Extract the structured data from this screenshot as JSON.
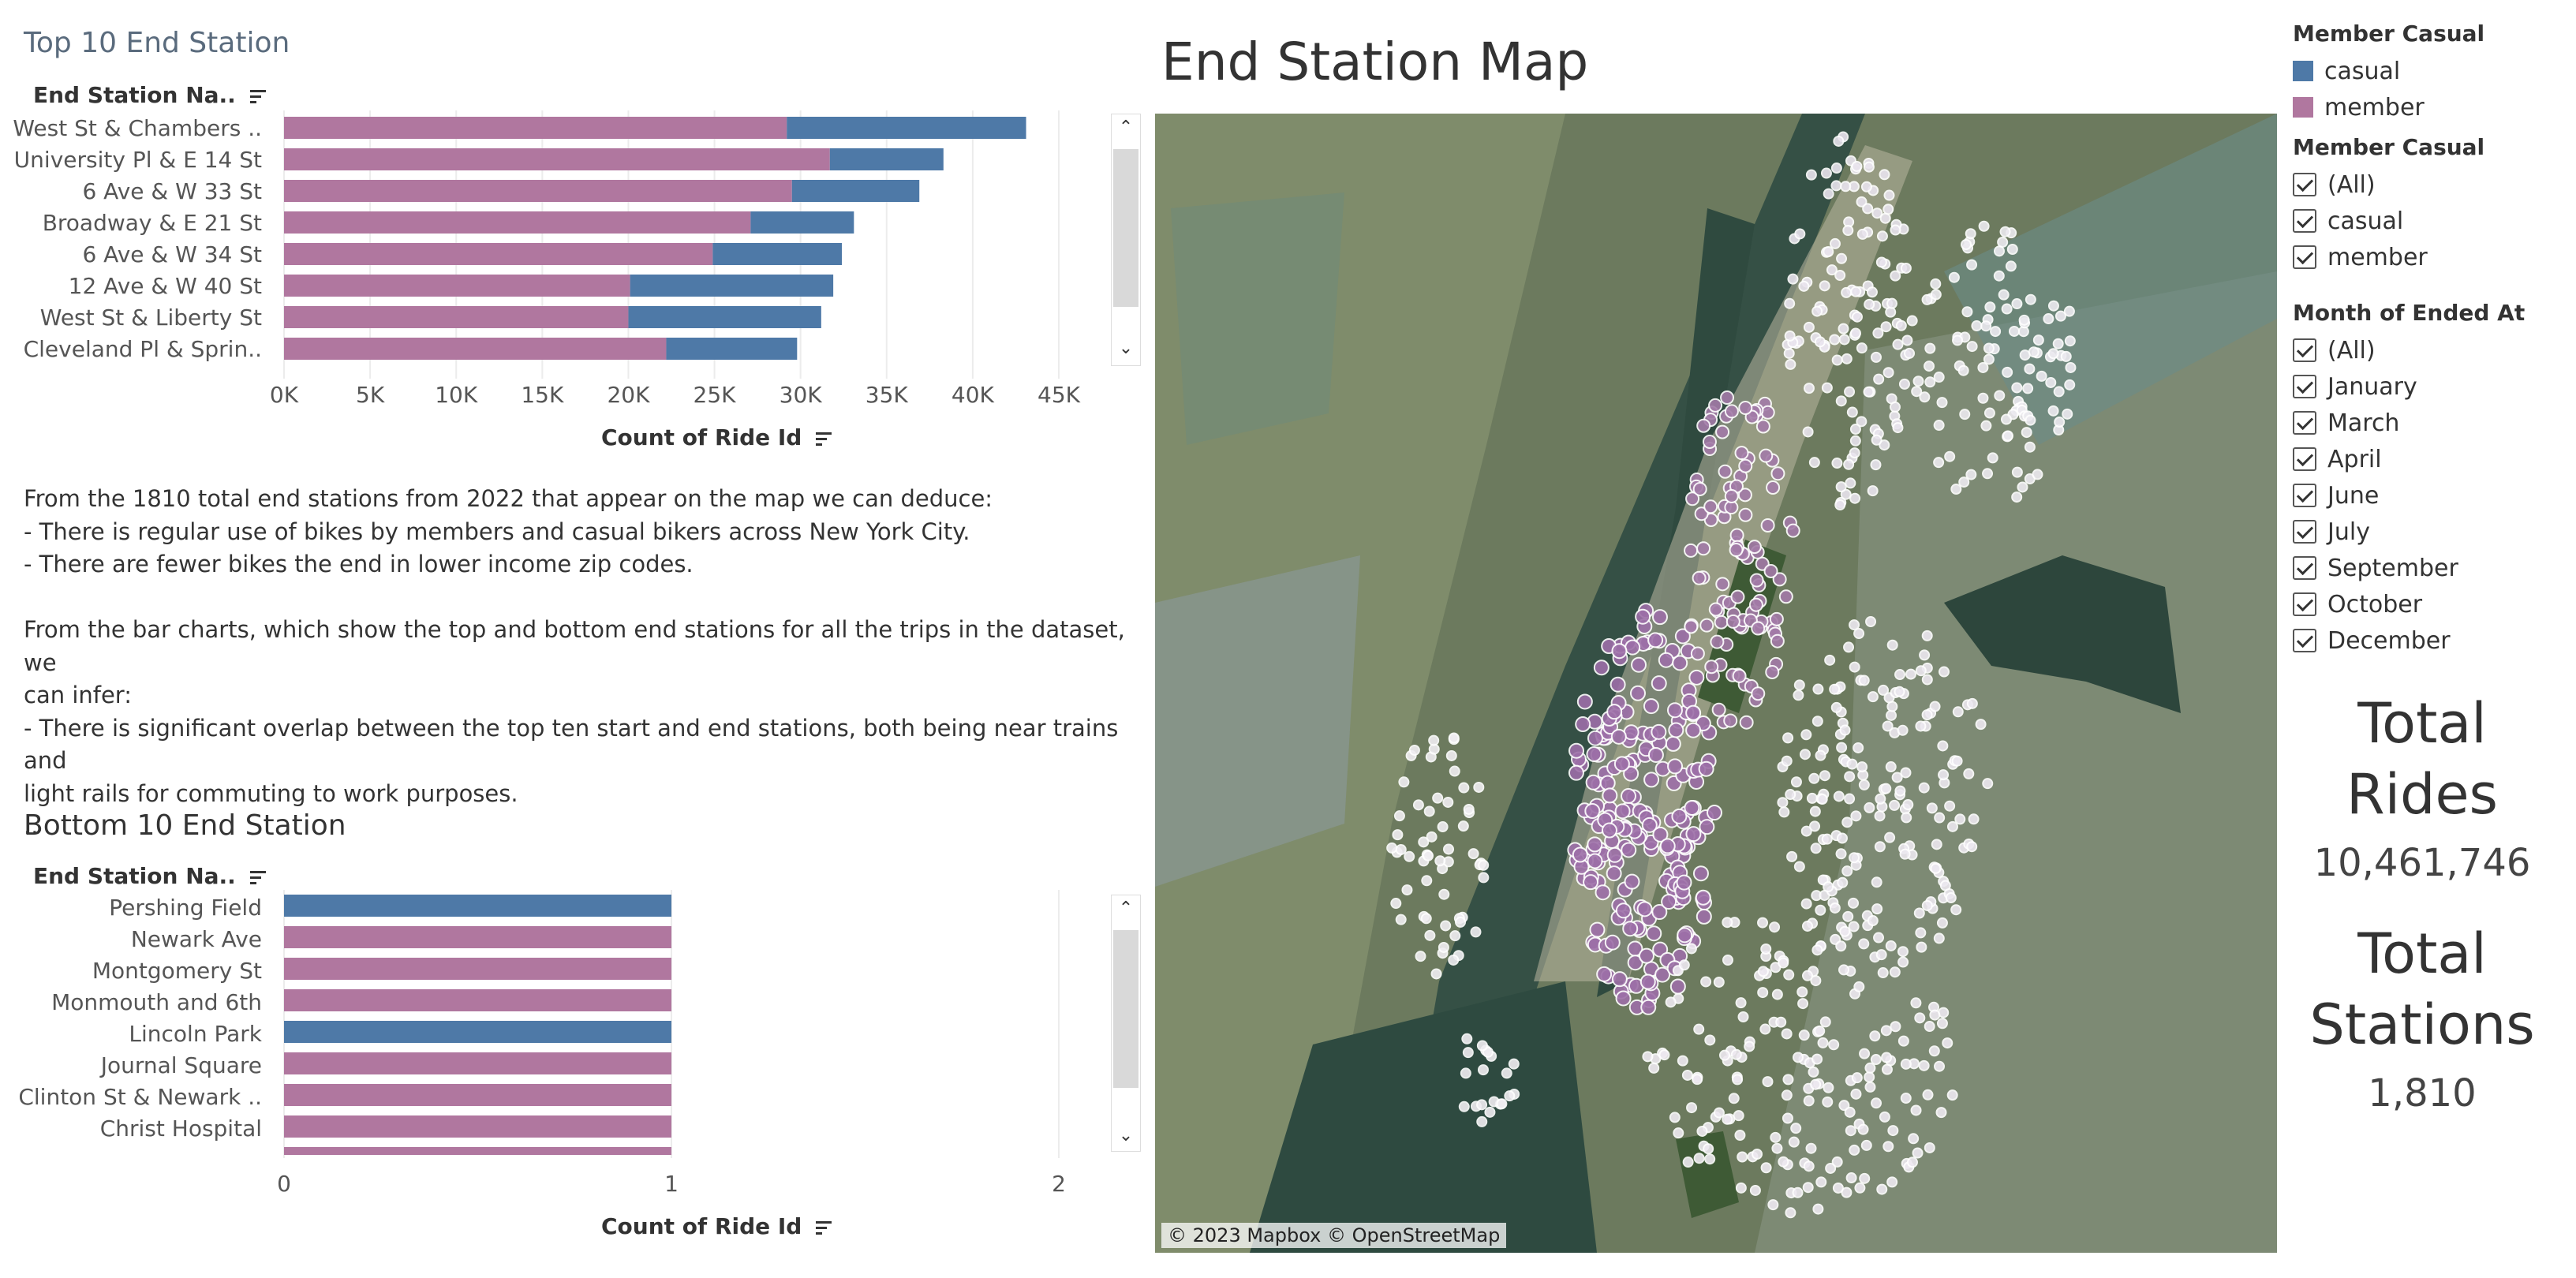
{
  "top_chart": {
    "title": "Top 10 End Station",
    "column_header": "End Station Na..",
    "axis_title": "Count of Ride Id",
    "ticks": [
      "0K",
      "5K",
      "10K",
      "15K",
      "20K",
      "25K",
      "30K",
      "35K",
      "40K",
      "45K"
    ]
  },
  "bottom_chart": {
    "title": "Bottom 10 End Station",
    "column_header": "End Station Na..",
    "axis_title": "Count of Ride Id",
    "ticks": [
      "0",
      "1",
      "2"
    ]
  },
  "chart_data": [
    {
      "type": "bar",
      "title": "Top 10 End Station",
      "ylabel": "End Station Na..",
      "xlabel": "Count of Ride Id",
      "xlim": [
        0,
        45000
      ],
      "stacked": true,
      "categories": [
        "West St & Chambers ..",
        "University Pl & E 14 St",
        "6 Ave & W 33 St",
        "Broadway & E 21 St",
        "6 Ave & W 34 St",
        "12 Ave & W 40 St",
        "West St & Liberty St",
        "Cleveland Pl & Sprin.."
      ],
      "series": [
        {
          "name": "member",
          "color": "#b0779f",
          "values": [
            29200,
            31700,
            29500,
            27100,
            24900,
            20100,
            20000,
            22200
          ]
        },
        {
          "name": "casual",
          "color": "#4e79a7",
          "values": [
            13900,
            6600,
            7400,
            6000,
            7500,
            11800,
            11200,
            7600
          ]
        }
      ]
    },
    {
      "type": "bar",
      "title": "Bottom 10 End Station",
      "ylabel": "End Station Na..",
      "xlabel": "Count of Ride Id",
      "xlim": [
        0,
        2
      ],
      "categories": [
        "Pershing Field",
        "Newark Ave",
        "Montgomery St",
        "Monmouth and 6th",
        "Lincoln Park",
        "Journal Square",
        "Clinton St & Newark ..",
        "Christ Hospital"
      ],
      "values": [
        1,
        1,
        1,
        1,
        1,
        1,
        1,
        1
      ],
      "colors": [
        "#4e79a7",
        "#b0779f",
        "#b0779f",
        "#b0779f",
        "#4e79a7",
        "#b0779f",
        "#b0779f",
        "#b0779f"
      ]
    }
  ],
  "notes": {
    "lines": [
      "From the 1810 total end stations from 2022 that appear on the map we can deduce:",
      "- There is regular use of bikes by members and casual bikers across New York City.",
      "- There are fewer bikes the end in lower income zip codes.",
      "",
      "From the bar charts, which show the top and bottom end stations for all the trips in the dataset, we",
      "can infer:",
      "- There is significant overlap between the top ten start and end stations, both being near trains and",
      "light rails for commuting to work purposes.",
      ".."
    ]
  },
  "map": {
    "title": "End Station Map",
    "attribution": "© 2023 Mapbox © OpenStreetMap"
  },
  "legend": {
    "title": "Member Casual",
    "items": [
      {
        "label": "casual",
        "color": "#4e79a7"
      },
      {
        "label": "member",
        "color": "#b0779f"
      }
    ]
  },
  "filter_member": {
    "title": "Member Casual",
    "items": [
      "(All)",
      "casual",
      "member"
    ]
  },
  "filter_month": {
    "title": "Month of Ended At",
    "items": [
      "(All)",
      "January",
      "March",
      "April",
      "June",
      "July",
      "September",
      "October",
      "December"
    ]
  },
  "kpis": {
    "rides_label_1": "Total",
    "rides_label_2": "Rides",
    "rides_value": "10,461,746",
    "stations_label_1": "Total",
    "stations_label_2": "Stations",
    "stations_value": "1,810"
  }
}
